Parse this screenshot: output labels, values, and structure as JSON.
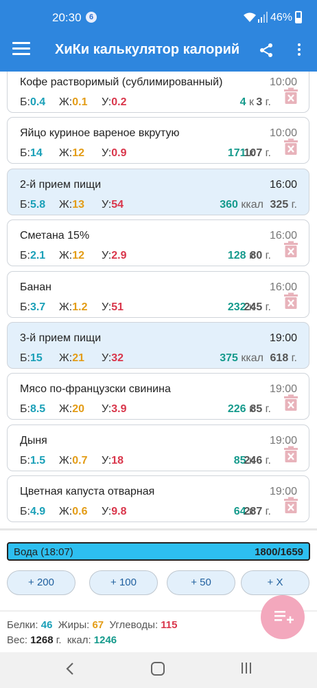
{
  "status": {
    "time": "20:30",
    "notif_count": "6",
    "battery": "46%"
  },
  "appbar": {
    "title": "ХиКи калькулятор калорий",
    "menu_icon": "hamburger-menu-icon",
    "share_icon": "share-icon",
    "more_icon": "more-vert-icon"
  },
  "labels": {
    "protein": "Б:",
    "fat": "Ж:",
    "carbs": "У:",
    "kcal_short": "к",
    "kcal_full": "ккал",
    "grams": "г."
  },
  "rows": [
    {
      "type": "food",
      "name": "Кофе растворимый (сублимированный)",
      "time": "10:00",
      "b": "0.4",
      "f": "0.1",
      "c": "0.2",
      "kcal": "4",
      "g": "3"
    },
    {
      "type": "food",
      "name": "Яйцо куриное вареное вкрутую",
      "time": "10:00",
      "b": "14",
      "f": "12",
      "c": "0.9",
      "kcal": "171",
      "g": "107"
    },
    {
      "type": "meal",
      "name": "2-й прием пищи",
      "time": "16:00",
      "b": "5.8",
      "f": "13",
      "c": "54",
      "kcal": "360",
      "g": "325"
    },
    {
      "type": "food",
      "name": "Сметана 15%",
      "time": "16:00",
      "b": "2.1",
      "f": "12",
      "c": "2.9",
      "kcal": "128",
      "g": "80"
    },
    {
      "type": "food",
      "name": "Банан",
      "time": "16:00",
      "b": "3.7",
      "f": "1.2",
      "c": "51",
      "kcal": "232",
      "g": "245"
    },
    {
      "type": "meal",
      "name": "3-й прием пищи",
      "time": "19:00",
      "b": "15",
      "f": "21",
      "c": "32",
      "kcal": "375",
      "g": "618"
    },
    {
      "type": "food",
      "name": "Мясо по-французски свинина",
      "time": "19:00",
      "b": "8.5",
      "f": "20",
      "c": "3.9",
      "kcal": "226",
      "g": "85"
    },
    {
      "type": "food",
      "name": "Дыня",
      "time": "19:00",
      "b": "1.5",
      "f": "0.7",
      "c": "18",
      "kcal": "85",
      "g": "246"
    },
    {
      "type": "food",
      "name": "Цветная капуста отварная",
      "time": "19:00",
      "b": "4.9",
      "f": "0.6",
      "c": "9.8",
      "kcal": "64",
      "g": "287"
    }
  ],
  "water": {
    "label": "Вода (18:07)",
    "value": "1800/1659"
  },
  "water_buttons": [
    "+ 200",
    "+ 100",
    "+ 50",
    "+ X"
  ],
  "totals": {
    "protein_label": "Белки:",
    "protein": "46",
    "fat_label": "Жиры:",
    "fat": "67",
    "carbs_label": "Углеводы:",
    "carbs": "115",
    "weight_label": "Вес:",
    "weight": "1268",
    "weight_unit": "г.",
    "kcal_label": "ккал:",
    "kcal": "1246"
  },
  "colors": {
    "primary": "#2e86de",
    "meal_bg": "#e3f0fb",
    "protein": "#1aa0b8",
    "fat": "#e39c16",
    "carbs": "#d9364b",
    "kcal": "#159a8c",
    "water": "#2dbff0",
    "fab": "#f3a8bd"
  }
}
